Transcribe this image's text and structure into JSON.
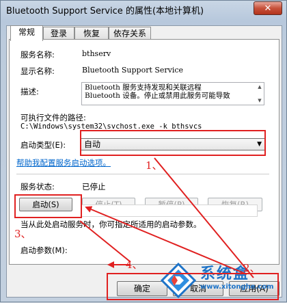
{
  "window": {
    "title": "Bluetooth Support Service 的属性(本地计算机)",
    "close_glyph": "✕"
  },
  "tabs": [
    {
      "label": "常规",
      "active": true
    },
    {
      "label": "登录",
      "active": false
    },
    {
      "label": "恢复",
      "active": false
    },
    {
      "label": "依存关系",
      "active": false
    }
  ],
  "general": {
    "service_name_label": "服务名称:",
    "service_name_value": "bthserv",
    "display_name_label": "显示名称:",
    "display_name_value": "Bluetooth Support Service",
    "description_label": "描述:",
    "description_line1": "Bluetooth 服务支持发现和关联远程",
    "description_line2": "Bluetooth 设备。停止或禁用此服务可能导致",
    "exe_path_label": "可执行文件的路径:",
    "exe_path_value": "C:\\Windows\\system32\\svchost.exe -k bthsvcs",
    "startup_type_label": "启动类型(E):",
    "startup_type_value": "自动",
    "help_link": "帮助我配置服务启动选项。",
    "status_label": "服务状态:",
    "status_value": "已停止",
    "buttons": {
      "start": "启动(S)",
      "stop": "停止(T)",
      "pause": "暂停(P)",
      "resume": "恢复(R)"
    },
    "hint": "当从此处启动服务时，你可指定所适用的启动参数。",
    "start_params_label": "启动参数(M):",
    "start_params_value": ""
  },
  "footer": {
    "ok": "确定",
    "cancel": "取消",
    "apply": "应用(A)"
  },
  "annotations": {
    "a1": "1、",
    "a2": "2、",
    "a3": "3、",
    "a4": "4、"
  },
  "watermark": {
    "brand": "系统盒",
    "url": "www.xitonghe.com"
  },
  "colors": {
    "annotation_red": "#e02020",
    "link_blue": "#0066cc",
    "brand_blue": "#1d73c8"
  }
}
